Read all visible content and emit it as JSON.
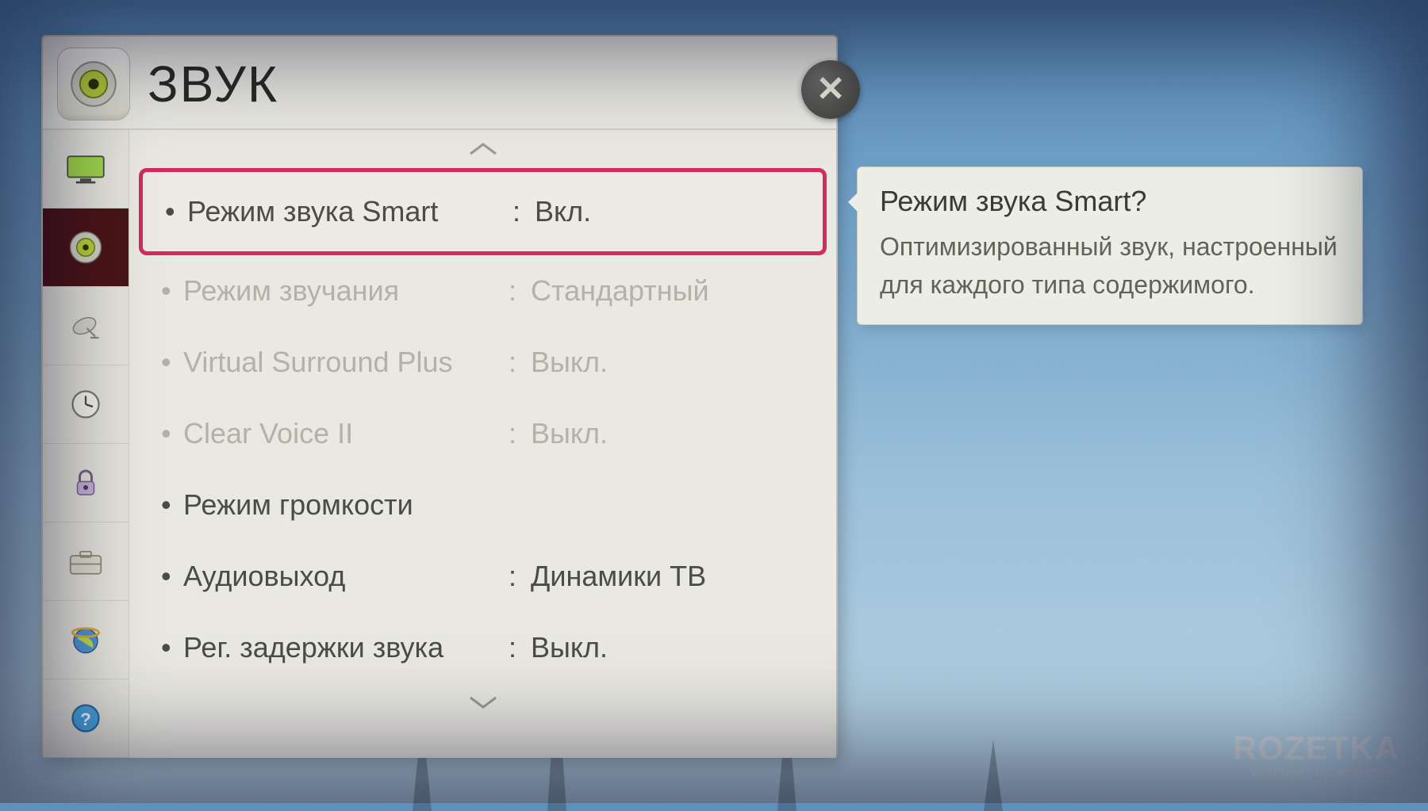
{
  "dialog": {
    "title": "ЗВУК",
    "close_label": "✕"
  },
  "sidebar": [
    {
      "name": "picture",
      "active": false
    },
    {
      "name": "sound",
      "active": true
    },
    {
      "name": "channel",
      "active": false
    },
    {
      "name": "time",
      "active": false
    },
    {
      "name": "lock",
      "active": false
    },
    {
      "name": "option",
      "active": false
    },
    {
      "name": "network",
      "active": false
    },
    {
      "name": "support",
      "active": false
    }
  ],
  "items": [
    {
      "label": "Режим звука Smart",
      "value": "Вкл.",
      "selected": true,
      "disabled": false
    },
    {
      "label": "Режим звучания",
      "value": "Стандартный",
      "selected": false,
      "disabled": true
    },
    {
      "label": "Virtual Surround Plus",
      "value": "Выкл.",
      "selected": false,
      "disabled": true
    },
    {
      "label": "Clear Voice II",
      "value": "Выкл.",
      "selected": false,
      "disabled": true
    },
    {
      "label": "Режим громкости",
      "value": "",
      "selected": false,
      "disabled": false
    },
    {
      "label": "Аудиовыход",
      "value": "Динамики ТВ",
      "selected": false,
      "disabled": false
    },
    {
      "label": "Рег. задержки звука",
      "value": "Выкл.",
      "selected": false,
      "disabled": false
    }
  ],
  "tooltip": {
    "title": "Режим звука Smart?",
    "body": "Оптимизированный звук, настроенный для каждого типа содержимого."
  },
  "watermark": {
    "brand": "ROZETKA",
    "tagline": "интернет супермаркет"
  }
}
